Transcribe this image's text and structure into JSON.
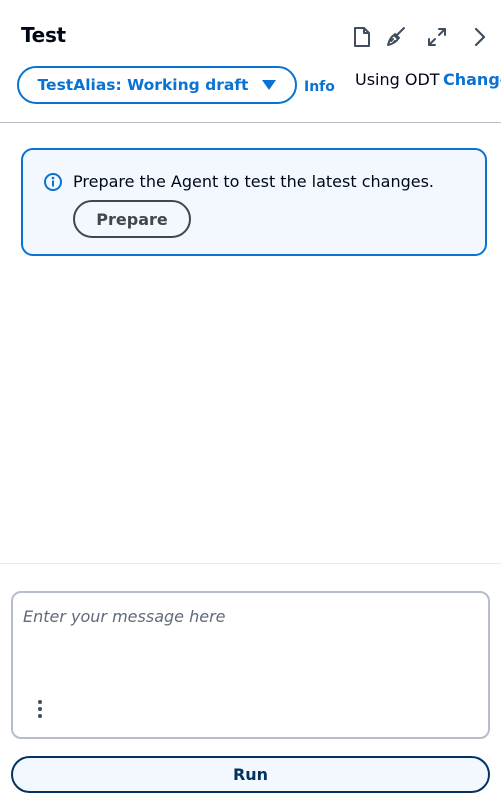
{
  "header": {
    "title": "Test",
    "icons": [
      "document-icon",
      "broom-icon",
      "expand-icon",
      "chevron-right-icon"
    ]
  },
  "alias": {
    "label": "TestAlias: Working draft",
    "info_label": "Info"
  },
  "odt": {
    "text": "Using ODT",
    "change_label": "Change"
  },
  "alert": {
    "message": "Prepare the Agent to test the latest changes.",
    "prepare_label": "Prepare"
  },
  "composer": {
    "placeholder": "Enter your message here",
    "run_label": "Run"
  },
  "colors": {
    "accent": "#0972d3",
    "alert_background": "#f2f8fd",
    "run_border": "#033160"
  }
}
